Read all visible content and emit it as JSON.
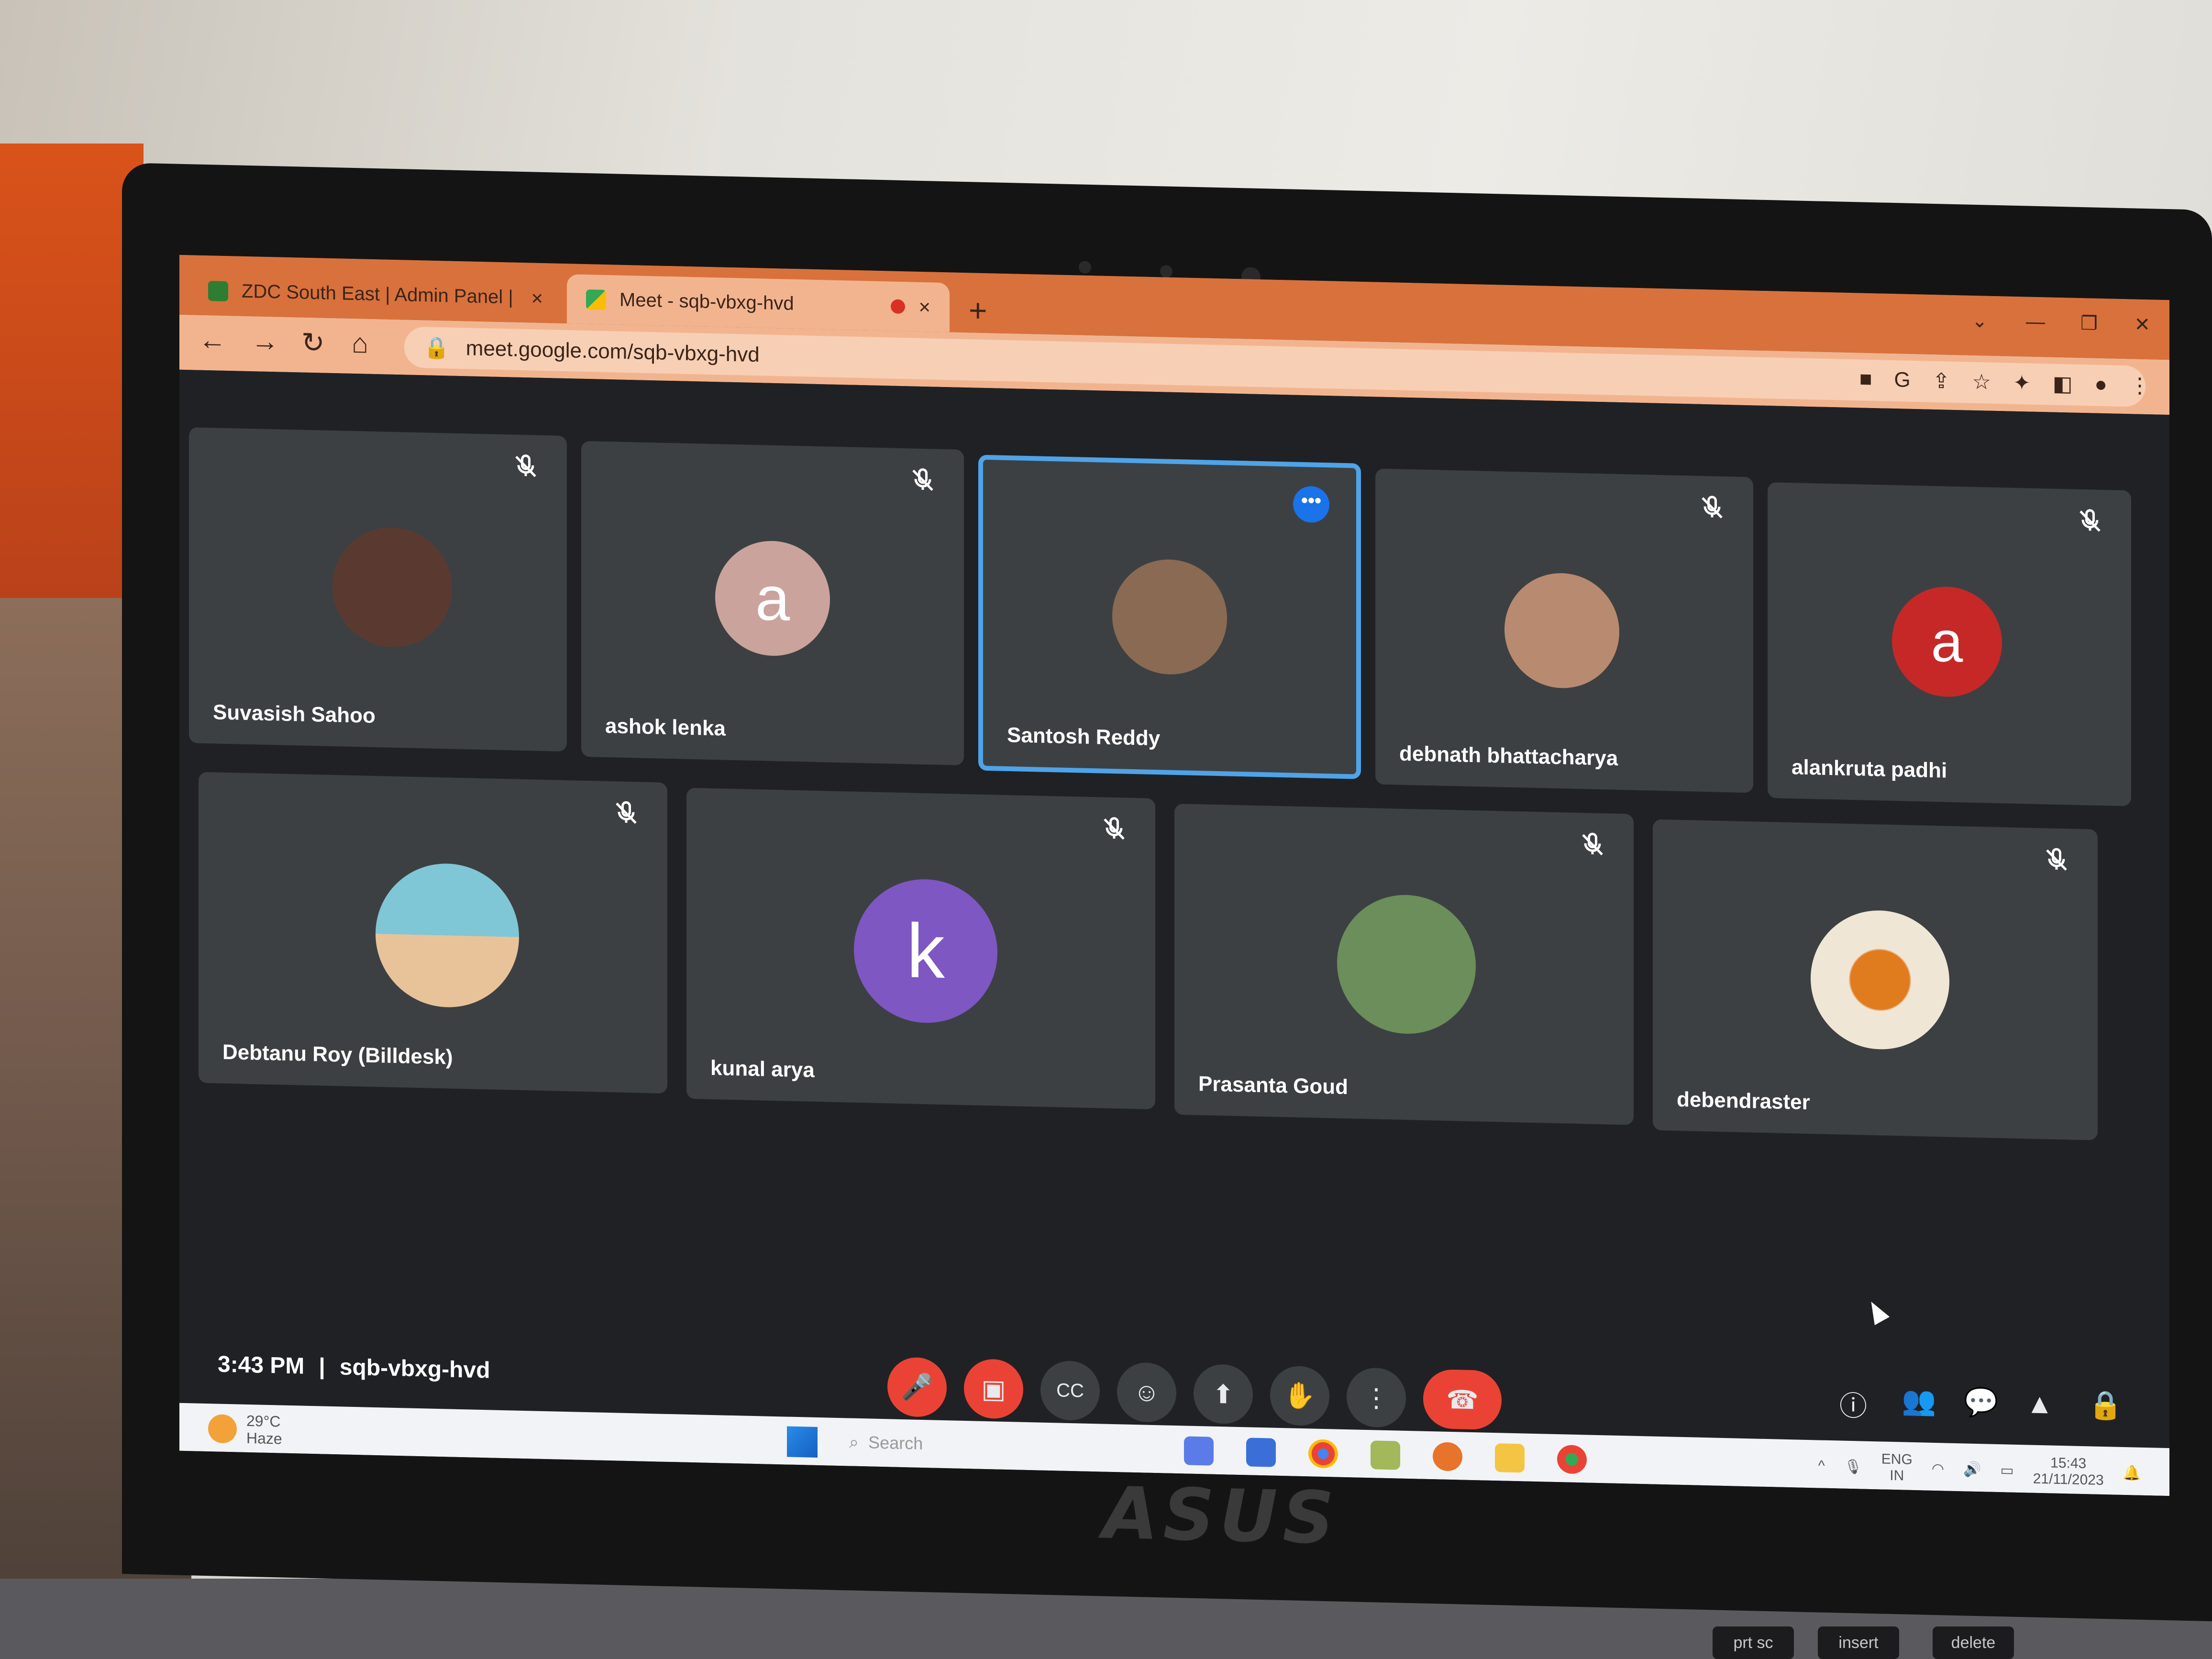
{
  "browser": {
    "tabs": [
      {
        "title": "ZDC South East | Admin Panel |",
        "active": false,
        "favicon_color": "#2e7d32"
      },
      {
        "title": "Meet - sqb-vbxg-hvd",
        "active": true,
        "favicon_color": "#34a853"
      }
    ],
    "new_tab_label": "+",
    "url": "meet.google.com/sqb-vbxg-hvd",
    "tab_close_glyph": "×"
  },
  "meeting": {
    "participants_row1": [
      {
        "name": "Suvasish Sahoo",
        "avatar_type": "photo",
        "avatar_color": "#5a3a30",
        "muted": true
      },
      {
        "name": "ashok lenka",
        "avatar_type": "letter",
        "letter": "a",
        "avatar_color": "#caa39c",
        "muted": true
      },
      {
        "name": "Santosh Reddy",
        "avatar_type": "photo",
        "avatar_color": "#8a6a52",
        "muted": false,
        "active_speaker": true
      },
      {
        "name": "debnath bhattacharya",
        "avatar_type": "photo",
        "avatar_color": "#b88a70",
        "muted": true
      },
      {
        "name": "alankruta padhi",
        "avatar_type": "letter",
        "letter": "a",
        "avatar_color": "#c62828",
        "muted": true
      }
    ],
    "participants_row2": [
      {
        "name": "Debtanu Roy (Billdesk)",
        "avatar_type": "photo",
        "avatar_color": "#7fc6d6",
        "muted": true
      },
      {
        "name": "kunal arya",
        "avatar_type": "letter",
        "letter": "k",
        "avatar_color": "#7e57c2",
        "muted": true
      },
      {
        "name": "Prasanta Goud",
        "avatar_type": "photo",
        "avatar_color": "#6b8e5a",
        "muted": true
      },
      {
        "name": "debendraster",
        "avatar_type": "photo",
        "avatar_color": "#e8dcc8",
        "muted": true
      }
    ],
    "time": "3:43 PM",
    "separator": "|",
    "code": "sqb-vbxg-hvd",
    "controls": [
      {
        "name": "mic-off-button",
        "icon": "mic-off-icon",
        "glyph": "🎤",
        "red": true
      },
      {
        "name": "camera-off-button",
        "icon": "camera-off-icon",
        "glyph": "▣",
        "red": true
      },
      {
        "name": "captions-button",
        "icon": "captions-icon",
        "glyph": "CC",
        "red": false
      },
      {
        "name": "emoji-button",
        "icon": "emoji-icon",
        "glyph": "☺",
        "red": false
      },
      {
        "name": "present-button",
        "icon": "present-icon",
        "glyph": "⬆",
        "red": false
      },
      {
        "name": "raise-hand-button",
        "icon": "hand-icon",
        "glyph": "✋",
        "red": false
      },
      {
        "name": "more-options-button",
        "icon": "more-vert-icon",
        "glyph": "⋮",
        "red": false
      }
    ],
    "end_call_glyph": "☎",
    "side_icons": [
      "info-icon",
      "people-icon",
      "chat-icon",
      "activities-icon",
      "host-controls-icon"
    ],
    "side_glyphs": [
      "ⓘ",
      "👥",
      "💬",
      "▲",
      "🔒"
    ]
  },
  "taskbar": {
    "temperature": "29°C",
    "weather": "Haze",
    "search_placeholder": "Search",
    "lang_top": "ENG",
    "lang_bottom": "IN",
    "clock_time": "15:43",
    "clock_date": "21/11/2023"
  },
  "device": {
    "brand": "ASUS",
    "keys": [
      "prt sc",
      "insert",
      "delete"
    ]
  }
}
